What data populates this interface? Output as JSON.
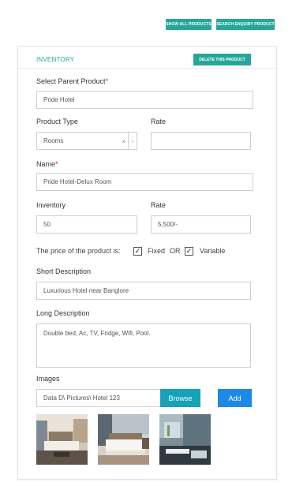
{
  "top_buttons": {
    "show_all": "SHOW ALL PRODUCTS",
    "search_enquiry": "SEARCH ENQUIRY PRODUCT"
  },
  "card": {
    "title": "INVENTORY",
    "delete_label": "DELETE THIS PRODUCT"
  },
  "form": {
    "parent_product": {
      "label": "Select Parent Product",
      "required_mark": "*",
      "value": "Pride Hotel"
    },
    "product_type": {
      "label": "Product Type",
      "value": "Rooms",
      "clear": "×",
      "caret": "⌄"
    },
    "rate_top": {
      "label": "Rate",
      "value": ""
    },
    "name": {
      "label": "Name",
      "required_mark": "*",
      "value": "Pride Hotel-Delux Room"
    },
    "inventory": {
      "label": "Inventory",
      "value": "50"
    },
    "rate": {
      "label": "Rate",
      "value": "5,500/-"
    },
    "price_type": {
      "prompt": "The price of the product is:",
      "fixed_label": "Fixed",
      "or_text": "OR",
      "variable_label": "Variable",
      "fixed_checked": true,
      "variable_checked": true,
      "check_glyph": "✓"
    },
    "short_description": {
      "label": "Short Description",
      "value": "Luxurious Hotel near Banglore"
    },
    "long_description": {
      "label": "Long Description",
      "value": "Double bed, Ac, TV, Fridge, Wifi, Pool."
    },
    "images": {
      "label": "Images",
      "file_path": "Data D\\ Pictures\\ Hotel 123",
      "browse_label": "Browse",
      "add_label": "Add"
    }
  },
  "colors": {
    "accent": "#26a69a",
    "browse": "#17a2b8",
    "add": "#1e88e5",
    "required": "#c62828"
  }
}
